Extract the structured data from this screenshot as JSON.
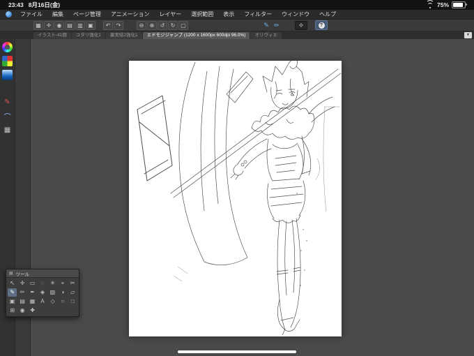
{
  "status_bar": {
    "time": "23:43",
    "date": "8月16日(金)",
    "battery_percent": "75%"
  },
  "menu_bar": {
    "items": [
      {
        "label": "ファイル"
      },
      {
        "label": "編集"
      },
      {
        "label": "ページ管理"
      },
      {
        "label": "アニメーション"
      },
      {
        "label": "レイヤー"
      },
      {
        "label": "選択範囲"
      },
      {
        "label": "表示"
      },
      {
        "label": "フィルター"
      },
      {
        "label": "ウィンドウ"
      },
      {
        "label": "ヘルプ"
      }
    ]
  },
  "toolbar": {
    "buttons": [
      {
        "name": "select-grid-icon",
        "glyph": "▦"
      },
      {
        "name": "move-page-icon",
        "glyph": "✛"
      },
      {
        "name": "eye-icon",
        "glyph": "◉"
      },
      {
        "name": "layers-icon",
        "glyph": "▤"
      },
      {
        "name": "panel-icon",
        "glyph": "▥"
      },
      {
        "name": "clipboard-icon",
        "glyph": "▣"
      },
      {
        "name": "undo-icon",
        "glyph": "↶"
      },
      {
        "name": "redo-icon",
        "glyph": "↷"
      },
      {
        "name": "zoom-out-icon",
        "glyph": "⊖"
      },
      {
        "name": "zoom-in-icon",
        "glyph": "⊕"
      },
      {
        "name": "rotate-ccw-icon",
        "glyph": "↺"
      },
      {
        "name": "rotate-cw-icon",
        "glyph": "↻"
      },
      {
        "name": "fit-screen-icon",
        "glyph": "▢"
      },
      {
        "name": "pen-icon",
        "glyph": "✎"
      },
      {
        "name": "brush-icon",
        "glyph": "✏"
      },
      {
        "name": "hand-tool-icon",
        "glyph": "✥"
      },
      {
        "name": "help-icon",
        "glyph": "?"
      }
    ]
  },
  "tab_bar": {
    "overflow_glyph": "▼",
    "tabs": [
      {
        "label": "イラスト-41個",
        "active": false
      },
      {
        "label": "ユタリ強化1",
        "active": false
      },
      {
        "label": "裏実結2強化1",
        "active": false
      },
      {
        "label": "エドモジジャンプ (1200 x 1600px 600dpi 96.0%)",
        "active": true
      },
      {
        "label": "オリヴィエ",
        "active": false
      }
    ]
  },
  "left_toolbar": {
    "icons": [
      {
        "name": "color-wheel-icon",
        "glyph": ""
      },
      {
        "name": "color-set-icon",
        "glyph": ""
      },
      {
        "name": "gradient-swatch-icon",
        "glyph": ""
      },
      {
        "name": "red-pen-icon",
        "glyph": "✎"
      },
      {
        "name": "airbrush-icon",
        "glyph": "⌒"
      },
      {
        "name": "pattern-icon",
        "glyph": "▦"
      }
    ]
  },
  "tool_palette": {
    "title": "ツール",
    "menu_icon": "▤",
    "tools": [
      {
        "name": "select-tool-icon",
        "glyph": "↖"
      },
      {
        "name": "move-tool-icon",
        "glyph": "✛"
      },
      {
        "name": "marquee-tool-icon",
        "glyph": "▭"
      },
      {
        "name": "lasso-tool-icon",
        "glyph": "◌"
      },
      {
        "name": "wand-tool-icon",
        "glyph": "✳"
      },
      {
        "name": "eyedropper-tool-icon",
        "glyph": "⌖"
      },
      {
        "name": "scissors-tool-icon",
        "glyph": "✂"
      },
      {
        "name": "pen-tool-icon",
        "glyph": "✎"
      },
      {
        "name": "pencil-tool-icon",
        "glyph": "✏"
      },
      {
        "name": "inkpen-tool-icon",
        "glyph": "✒"
      },
      {
        "name": "decoration-tool-icon",
        "glyph": "◈"
      },
      {
        "name": "hatching-tool-icon",
        "glyph": "▨"
      },
      {
        "name": "blend-tool-icon",
        "glyph": "◑"
      },
      {
        "name": "eraser-tool-icon",
        "glyph": "▱"
      },
      {
        "name": "fill-tool-icon",
        "glyph": "▣"
      },
      {
        "name": "gradient-tool-icon",
        "glyph": "▤"
      },
      {
        "name": "pattern-tool-icon",
        "glyph": "▦"
      },
      {
        "name": "text-tool-icon",
        "glyph": "A"
      },
      {
        "name": "shape-tool-icon",
        "glyph": "◇"
      },
      {
        "name": "ellipse-tool-icon",
        "glyph": "○"
      },
      {
        "name": "rect-tool-icon",
        "glyph": "□"
      },
      {
        "name": "frame-tool-icon",
        "glyph": "⊞"
      },
      {
        "name": "figure-tool-icon",
        "glyph": "◉"
      },
      {
        "name": "correction-tool-icon",
        "glyph": "✚"
      }
    ]
  }
}
